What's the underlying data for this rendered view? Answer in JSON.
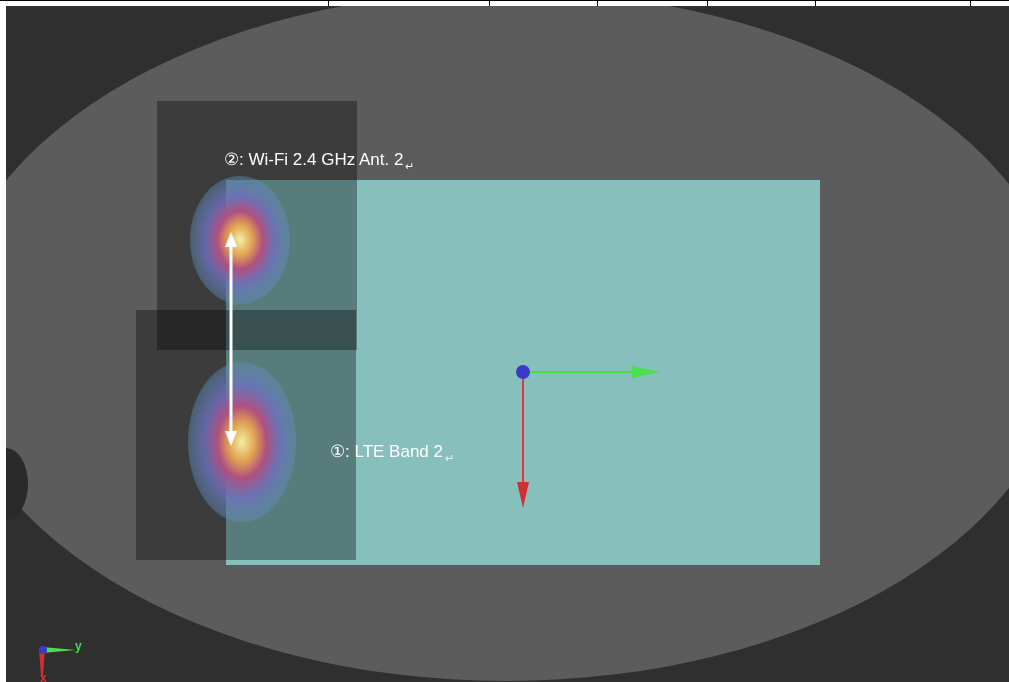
{
  "viewport": {
    "labels": [
      {
        "text": "②: Wi-Fi 2.4 GHz Ant. 2",
        "mark": "↵"
      },
      {
        "text": "①: LTE Band 2",
        "mark": "↵"
      }
    ],
    "axis_labels": [
      "y",
      "x"
    ]
  }
}
